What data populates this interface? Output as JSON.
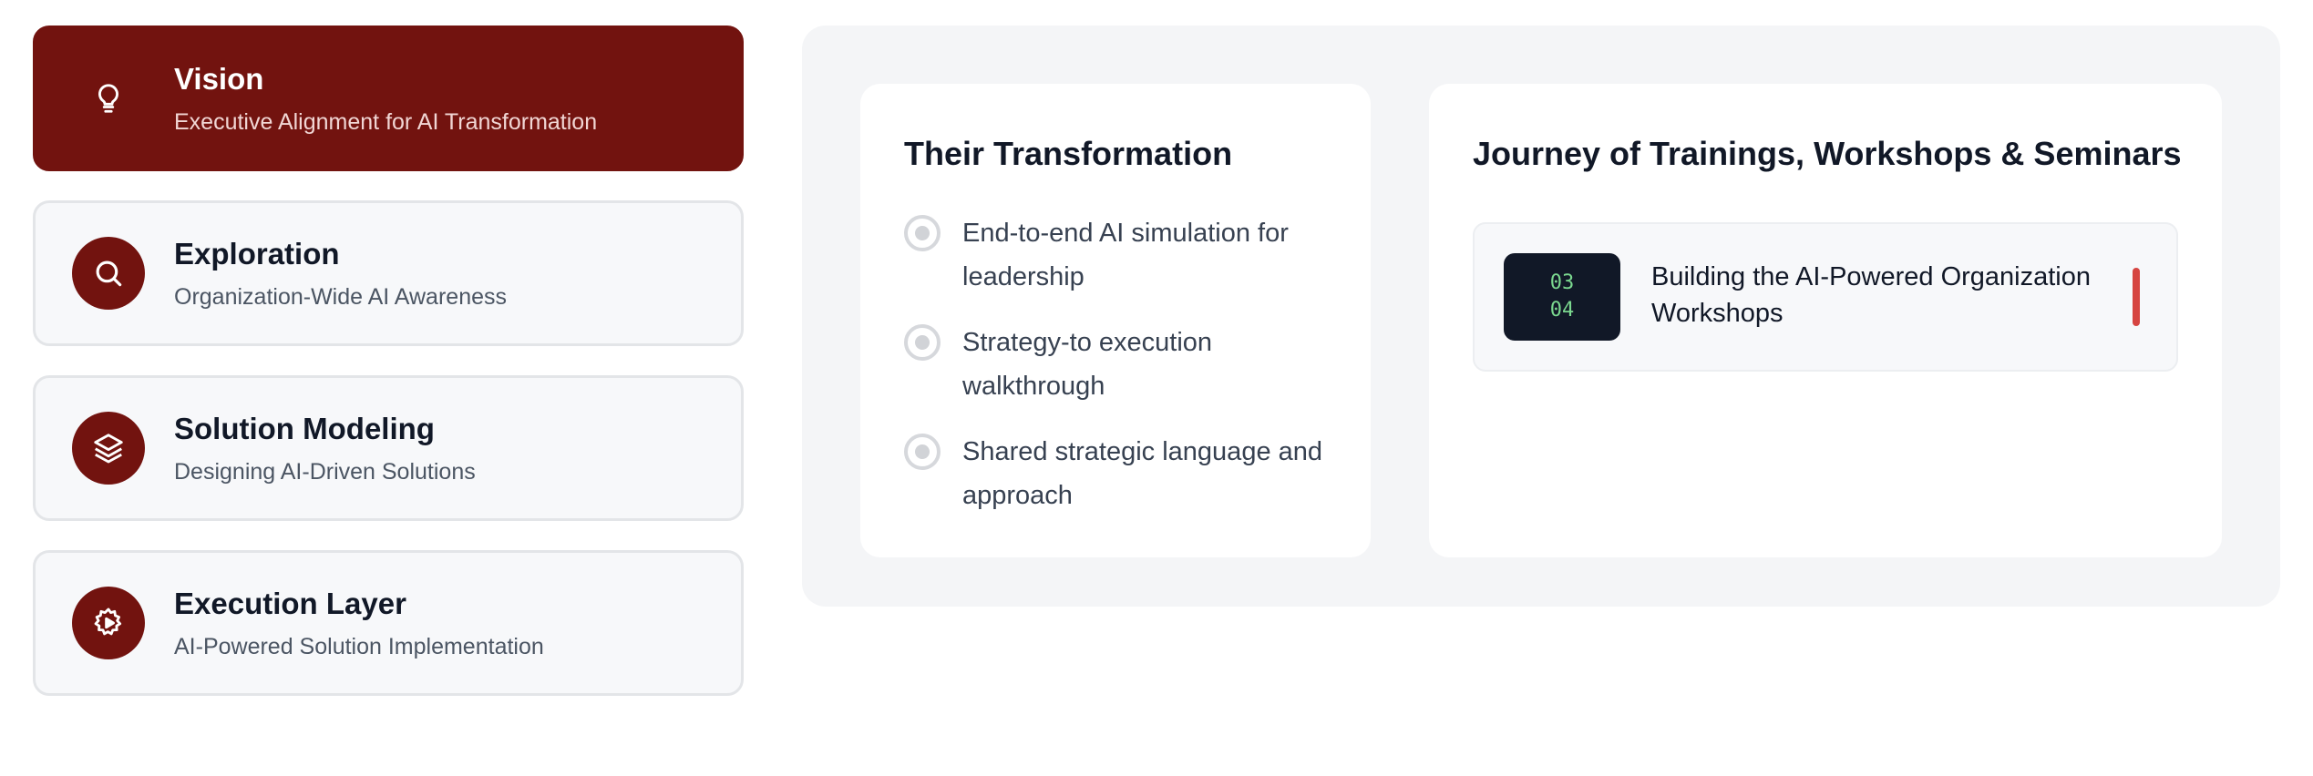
{
  "steps": [
    {
      "title": "Vision",
      "subtitle": "Executive Alignment for AI Transformation",
      "icon": "lightbulb-icon",
      "active": true
    },
    {
      "title": "Exploration",
      "subtitle": "Organization-Wide AI Awareness",
      "icon": "search-icon",
      "active": false
    },
    {
      "title": "Solution Modeling",
      "subtitle": "Designing AI-Driven Solutions",
      "icon": "layers-icon",
      "active": false
    },
    {
      "title": "Execution Layer",
      "subtitle": "AI-Powered Solution Implementation",
      "icon": "gear-play-icon",
      "active": false
    }
  ],
  "transformation": {
    "heading": "Their Transformation",
    "items": [
      "End-to-end AI simulation for leadership",
      "Strategy-to execution walkthrough",
      "Shared strategic language and approach"
    ]
  },
  "journey": {
    "heading": "Journey of Trainings, Workshops & Seminars",
    "items": [
      {
        "code_top": "03",
        "code_bottom": "04",
        "label": "Building the AI-Powered Organization Workshops"
      }
    ]
  },
  "colors": {
    "brand": "#72130f",
    "panel_bg": "#f4f5f7",
    "accent_bar": "#d64541",
    "code_text": "#7bd88f"
  }
}
